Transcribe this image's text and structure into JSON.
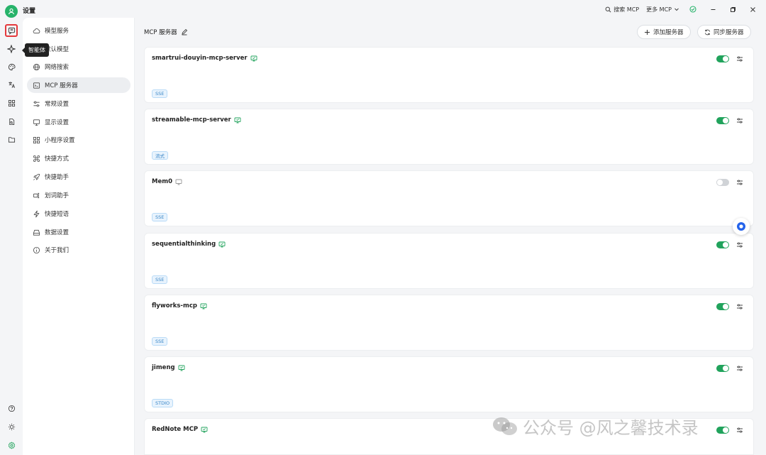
{
  "app": {
    "title": "设置"
  },
  "titlebar": {
    "search_label": "搜索 MCP",
    "more_label": "更多 MCP"
  },
  "tooltip": "智能体",
  "menu": {
    "items": [
      {
        "label": "模型服务",
        "icon": "cloud-icon"
      },
      {
        "label": "默认模型",
        "icon": "cube-icon"
      },
      {
        "label": "网络搜索",
        "icon": "globe-icon"
      },
      {
        "label": "MCP 服务器",
        "icon": "terminal-icon",
        "active": true
      },
      {
        "label": "常规设置",
        "icon": "sliders-icon"
      },
      {
        "label": "显示设置",
        "icon": "monitor-icon"
      },
      {
        "label": "小程序设置",
        "icon": "grid-icon"
      },
      {
        "label": "快捷方式",
        "icon": "command-icon"
      },
      {
        "label": "快捷助手",
        "icon": "rocket-icon"
      },
      {
        "label": "划词助手",
        "icon": "text-select-icon"
      },
      {
        "label": "快捷短语",
        "icon": "bolt-icon"
      },
      {
        "label": "数据设置",
        "icon": "drive-icon"
      },
      {
        "label": "关于我们",
        "icon": "info-icon"
      }
    ]
  },
  "main": {
    "header_title": "MCP 服务器",
    "add_button": "添加服务器",
    "sync_button": "同步服务器",
    "servers": [
      {
        "name": "smartrui-douyin-mcp-server",
        "enabled": true,
        "tag": "SSE"
      },
      {
        "name": "streamable-mcp-server",
        "enabled": true,
        "tag": "流式"
      },
      {
        "name": "Mem0",
        "enabled": false,
        "tag": "SSE"
      },
      {
        "name": "sequentialthinking",
        "enabled": true,
        "tag": "SSE"
      },
      {
        "name": "flyworks-mcp",
        "enabled": true,
        "tag": "SSE"
      },
      {
        "name": "jimeng",
        "enabled": true,
        "tag": "STDIO"
      },
      {
        "name": "RedNote MCP",
        "enabled": true,
        "tag": ""
      }
    ]
  },
  "watermark": "公众号 @风之馨技术录",
  "colors": {
    "accent": "#21a35c",
    "highlight": "#e4393c",
    "tag_blue": "#3a87c8"
  }
}
